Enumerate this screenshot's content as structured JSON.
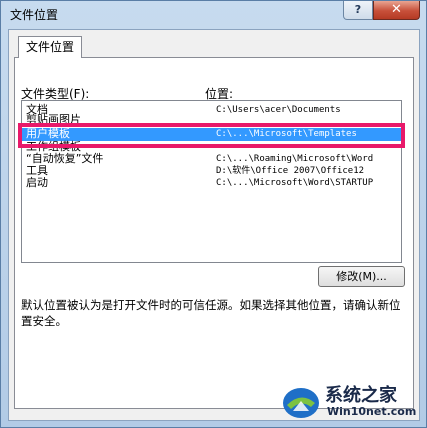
{
  "window": {
    "title": "文件位置",
    "help_label": "?",
    "close_label": "✕"
  },
  "tab": {
    "label": "文件位置"
  },
  "labels": {
    "file_types": "文件类型(F):",
    "location": "位置:"
  },
  "rows": [
    {
      "type": "文档",
      "path": "C:\\Users\\acer\\Documents",
      "selected": false
    },
    {
      "type": "剪贴画图片",
      "path": "",
      "selected": false
    },
    {
      "type": "用户模板",
      "path": "C:\\...\\Microsoft\\Templates",
      "selected": true
    },
    {
      "type": "工作组模板",
      "path": "",
      "selected": false
    },
    {
      "type": "“自动恢复”文件",
      "path": "C:\\...\\Roaming\\Microsoft\\Word",
      "selected": false
    },
    {
      "type": "工具",
      "path": "D:\\软件\\Office 2007\\Office12",
      "selected": false
    },
    {
      "type": "启动",
      "path": "C:\\...\\Microsoft\\Word\\STARTUP",
      "selected": false
    }
  ],
  "buttons": {
    "modify": "修改(M)..."
  },
  "note": "默认位置被认为是打开文件时的可信任源。如果选择其他位置，请确认新位置安全。",
  "watermark": {
    "name": "系统之家",
    "url": "Win10net.com"
  },
  "colors": {
    "selection": "#3399ff",
    "annotation_box": "#e8196a"
  }
}
